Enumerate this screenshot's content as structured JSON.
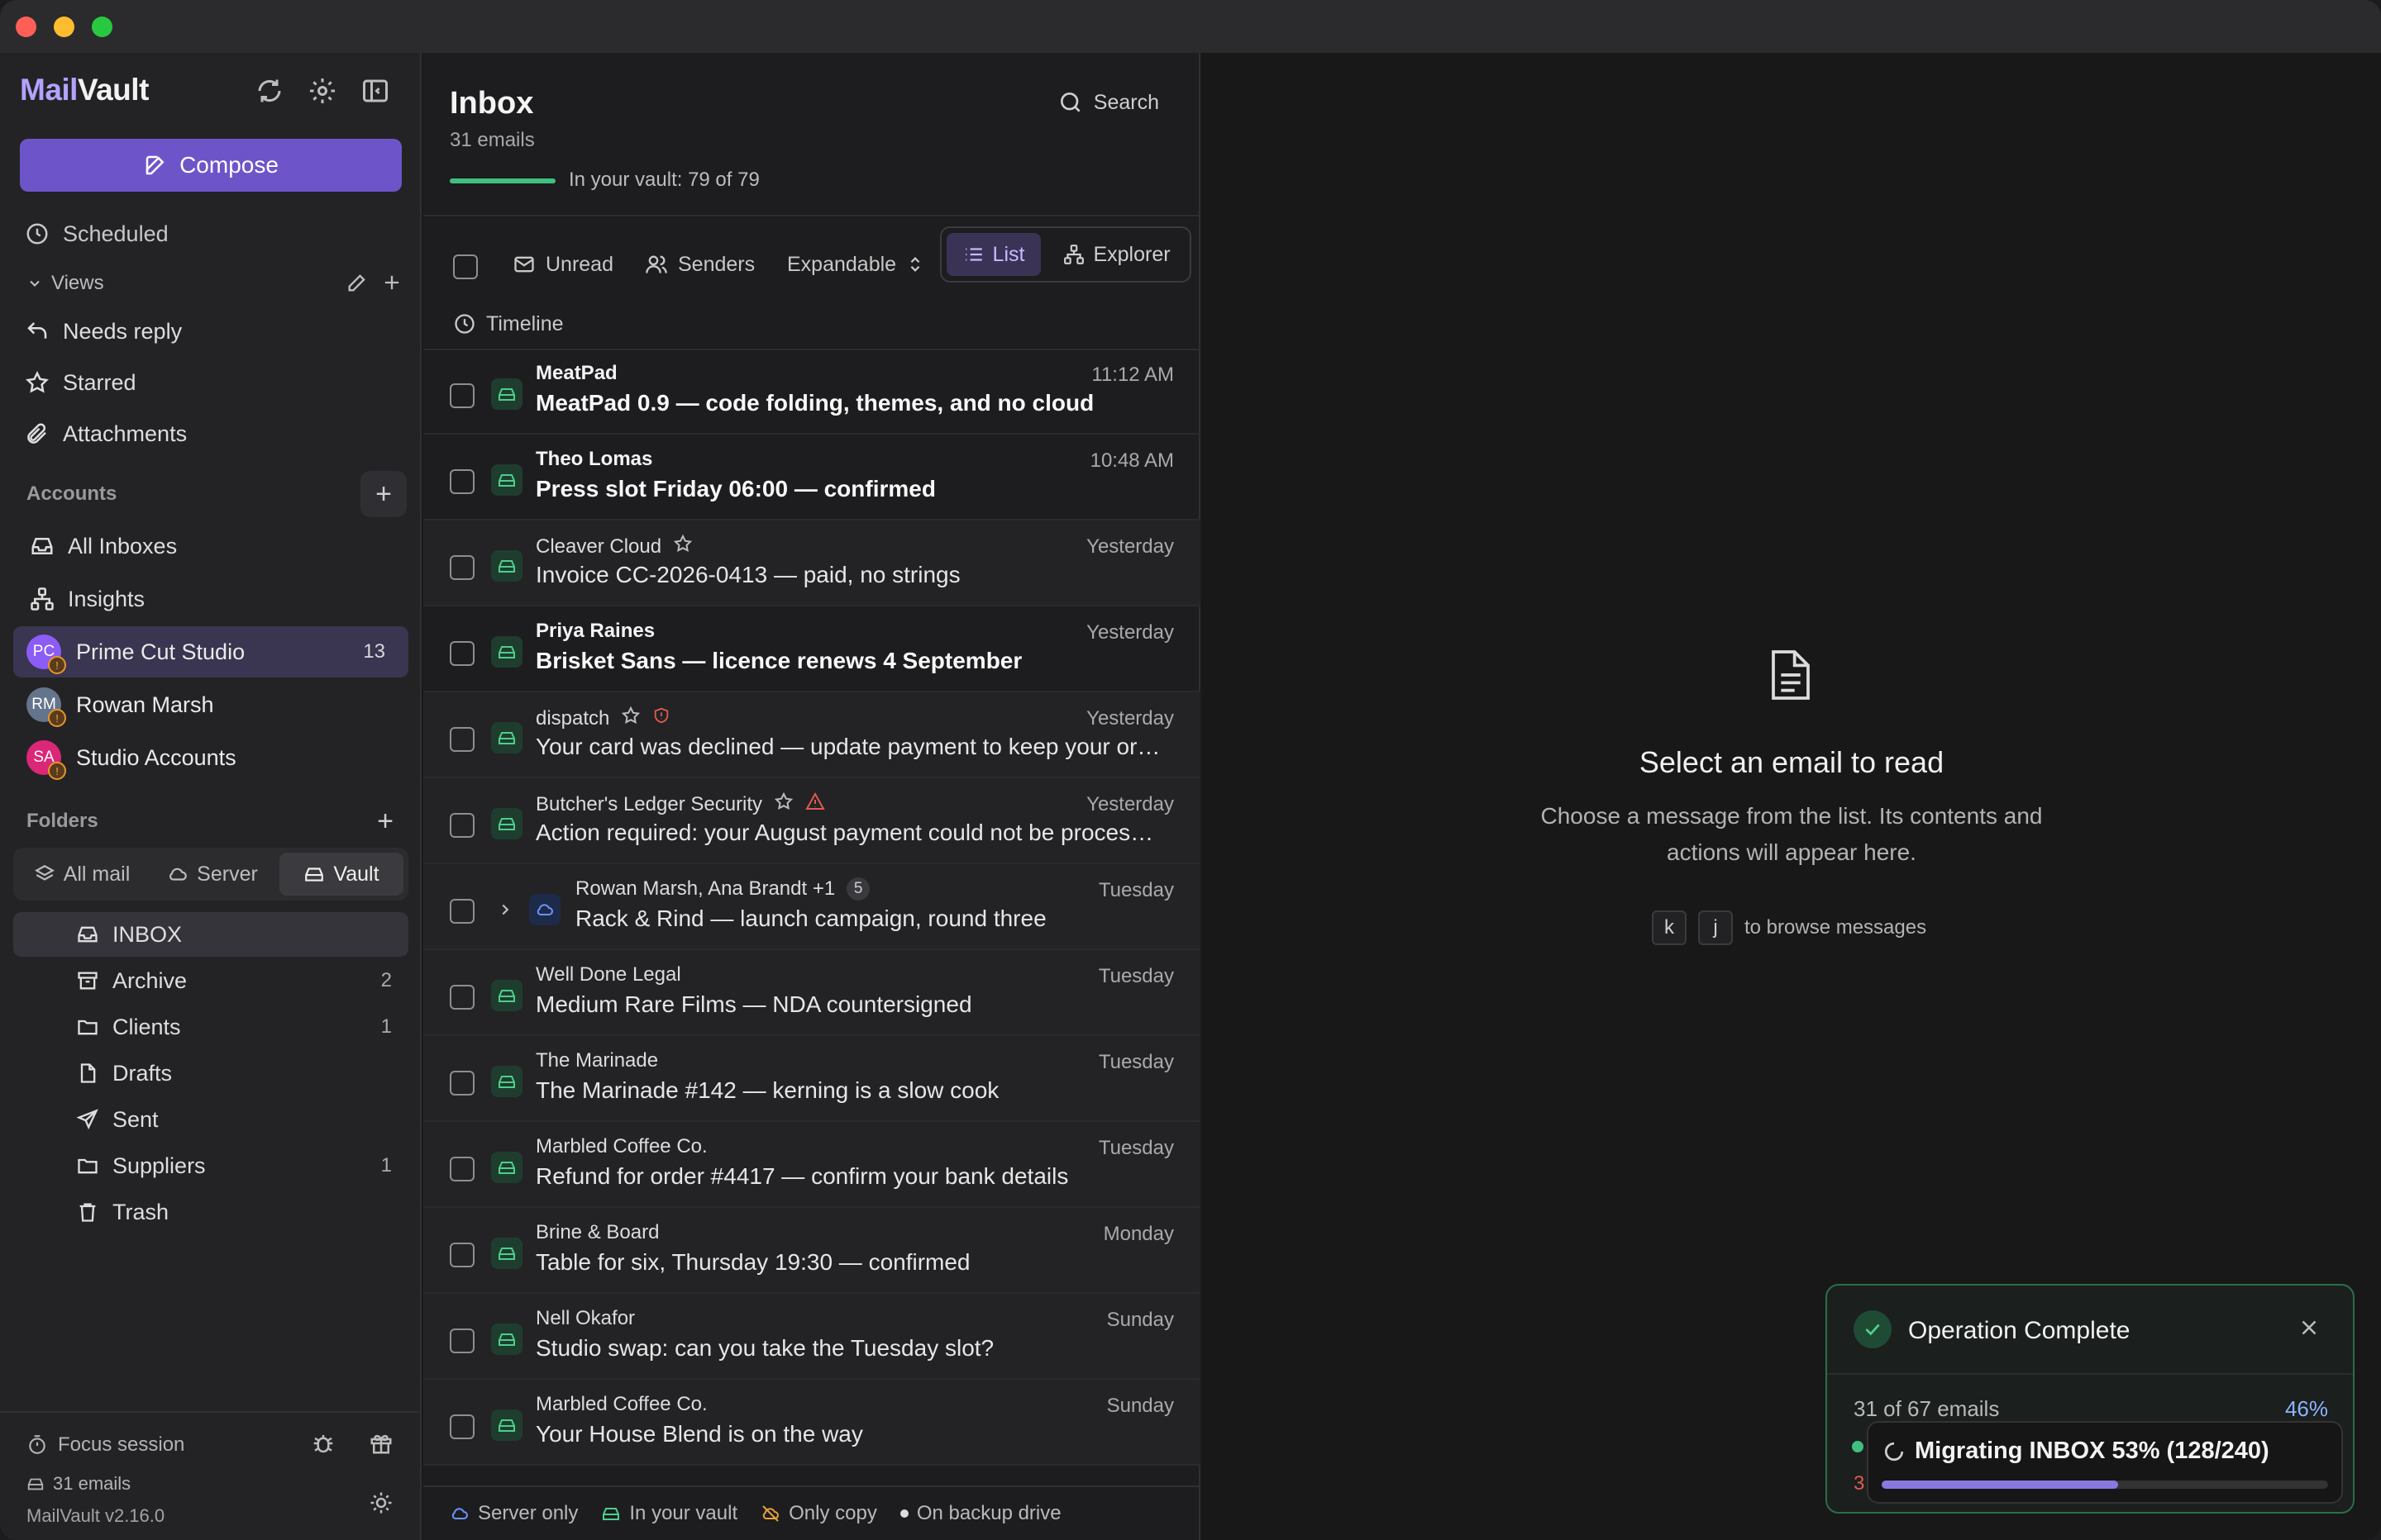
{
  "app": {
    "brand_part1": "Mail",
    "brand_part2": "Vault",
    "version": "MailVault v2.16.0"
  },
  "sidebar": {
    "compose_label": "Compose",
    "scheduled_label": "Scheduled",
    "views_label": "Views",
    "views": [
      {
        "label": "Needs reply",
        "icon": "reply-icon"
      },
      {
        "label": "Starred",
        "icon": "star-icon"
      },
      {
        "label": "Attachments",
        "icon": "paperclip-icon"
      }
    ],
    "accounts_label": "Accounts",
    "accounts": [
      {
        "label": "All Inboxes",
        "icon": "inbox-icon"
      },
      {
        "label": "Insights",
        "icon": "insights-icon"
      }
    ],
    "account_profiles": [
      {
        "initials": "PC",
        "label": "Prime Cut Studio",
        "count": "13",
        "color": "#8b5cf6"
      },
      {
        "initials": "RM",
        "label": "Rowan Marsh",
        "count": "",
        "color": "#64748b"
      },
      {
        "initials": "SA",
        "label": "Studio Accounts",
        "count": "",
        "color": "#db2777"
      }
    ],
    "folders_label": "Folders",
    "folder_tabs": [
      "All mail",
      "Server",
      "Vault"
    ],
    "folders": [
      {
        "label": "INBOX",
        "count": "",
        "icon": "inbox-icon"
      },
      {
        "label": "Archive",
        "count": "2",
        "icon": "archive-icon"
      },
      {
        "label": "Clients",
        "count": "1",
        "icon": "folder-icon"
      },
      {
        "label": "Drafts",
        "count": "",
        "icon": "file-icon"
      },
      {
        "label": "Sent",
        "count": "",
        "icon": "send-icon"
      },
      {
        "label": "Suppliers",
        "count": "1",
        "icon": "folder-icon"
      },
      {
        "label": "Trash",
        "count": "",
        "icon": "trash-icon"
      }
    ],
    "focus_label": "Focus session",
    "footer_emails": "31 emails"
  },
  "list": {
    "title": "Inbox",
    "count": "31 emails",
    "vault_text": "In your vault: 79 of 79",
    "vault_progress": 1.0,
    "search_label": "Search",
    "filters": {
      "unread": "Unread",
      "senders": "Senders",
      "expandable": "Expandable",
      "list": "List",
      "explorer": "Explorer",
      "timeline": "Timeline"
    },
    "emails": [
      {
        "sender": "MeatPad",
        "subject": "MeatPad 0.9 — code folding, themes, and no cloud",
        "time": "11:12 AM",
        "unread": true
      },
      {
        "sender": "Theo Lomas",
        "subject": "Press slot Friday 06:00 — confirmed",
        "time": "10:48 AM",
        "unread": true
      },
      {
        "sender": "Cleaver Cloud",
        "subject": "Invoice CC-2026-0413 — paid, no strings",
        "time": "Yesterday",
        "unread": false,
        "star": true
      },
      {
        "sender": "Priya Raines",
        "subject": "Brisket Sans — licence renews 4 September",
        "time": "Yesterday",
        "unread": true
      },
      {
        "sender": "dispatch",
        "subject": "Your card was declined — update payment to keep your order",
        "time": "Yesterday",
        "unread": false,
        "star": true,
        "shield": true
      },
      {
        "sender": "Butcher's Ledger Security",
        "subject": "Action required: your August payment could not be processed",
        "time": "Yesterday",
        "unread": false,
        "star": true,
        "warning": true
      },
      {
        "sender": "Rowan Marsh, Ana Brandt +1",
        "subject": "Rack & Rind — launch campaign, round three",
        "time": "Tuesday",
        "unread": false,
        "thread": "5"
      },
      {
        "sender": "Well Done Legal",
        "subject": "Medium Rare Films — NDA countersigned",
        "time": "Tuesday",
        "unread": false
      },
      {
        "sender": "The Marinade",
        "subject": "The Marinade #142 — kerning is a slow cook",
        "time": "Tuesday",
        "unread": false
      },
      {
        "sender": "Marbled Coffee Co.",
        "subject": "Refund for order #4417 — confirm your bank details",
        "time": "Tuesday",
        "unread": false
      },
      {
        "sender": "Brine & Board",
        "subject": "Table for six, Thursday 19:30 — confirmed",
        "time": "Monday",
        "unread": false
      },
      {
        "sender": "Nell Okafor",
        "subject": "Studio swap: can you take the Tuesday slot?",
        "time": "Sunday",
        "unread": false
      },
      {
        "sender": "Marbled Coffee Co.",
        "subject": "Your House Blend is on the way",
        "time": "Sunday",
        "unread": false
      }
    ],
    "legend": {
      "server_only": "Server only",
      "in_vault": "In your vault",
      "only_copy": "Only copy",
      "backup": "On backup drive"
    }
  },
  "reader": {
    "empty_title": "Select an email to read",
    "empty_desc": "Choose a message from the list. Its contents and actions will appear here.",
    "key1": "k",
    "key2": "j",
    "browse_hint": "to browse messages"
  },
  "toast": {
    "title": "Operation Complete",
    "subtitle": "31 of 67 emails",
    "percent": "46%",
    "migrating": "Migrating INBOX 53% (128/240)",
    "migrate_progress": 0.53,
    "red_text": "3"
  }
}
